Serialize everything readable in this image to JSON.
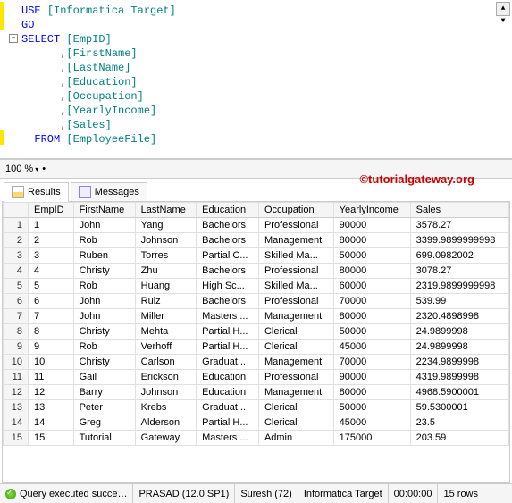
{
  "sql": {
    "line1_kw": "USE ",
    "line1_obj": "[Informatica Target]",
    "line2": "GO",
    "line3_kw": "SELECT ",
    "line3_obj": "[EmpID]",
    "line4": "      ,[FirstName]",
    "line5": "      ,[LastName]",
    "line6": "      ,[Education]",
    "line7": "      ,[Occupation]",
    "line8": "      ,[YearlyIncome]",
    "line9": "      ,[Sales]",
    "line10_kw": "  FROM ",
    "line10_obj": "[EmployeeFile]"
  },
  "zoom": {
    "level": "100 %"
  },
  "watermark": "©tutorialgateway.org",
  "tabs": {
    "results": "Results",
    "messages": "Messages"
  },
  "grid": {
    "headers": [
      "EmpID",
      "FirstName",
      "LastName",
      "Education",
      "Occupation",
      "YearlyIncome",
      "Sales"
    ],
    "rows": [
      [
        "1",
        "John",
        "Yang",
        "Bachelors",
        "Professional",
        "90000",
        "3578.27"
      ],
      [
        "2",
        "Rob",
        "Johnson",
        "Bachelors",
        "Management",
        "80000",
        "3399.9899999998"
      ],
      [
        "3",
        "Ruben",
        "Torres",
        "Partial C...",
        "Skilled Ma...",
        "50000",
        "699.0982002"
      ],
      [
        "4",
        "Christy",
        "Zhu",
        "Bachelors",
        "Professional",
        "80000",
        "3078.27"
      ],
      [
        "5",
        "Rob",
        "Huang",
        "High Sc...",
        "Skilled Ma...",
        "60000",
        "2319.9899999998"
      ],
      [
        "6",
        "John",
        "Ruiz",
        "Bachelors",
        "Professional",
        "70000",
        "539.99"
      ],
      [
        "7",
        "John",
        "Miller",
        "Masters ...",
        "Management",
        "80000",
        "2320.4898998"
      ],
      [
        "8",
        "Christy",
        "Mehta",
        "Partial H...",
        "Clerical",
        "50000",
        "24.9899998"
      ],
      [
        "9",
        "Rob",
        "Verhoff",
        "Partial H...",
        "Clerical",
        "45000",
        "24.9899998"
      ],
      [
        "10",
        "Christy",
        "Carlson",
        "Graduat...",
        "Management",
        "70000",
        "2234.9899998"
      ],
      [
        "11",
        "Gail",
        "Erickson",
        "Education",
        "Professional",
        "90000",
        "4319.9899998"
      ],
      [
        "12",
        "Barry",
        "Johnson",
        "Education",
        "Management",
        "80000",
        "4968.5900001"
      ],
      [
        "13",
        "Peter",
        "Krebs",
        "Graduat...",
        "Clerical",
        "50000",
        "59.5300001"
      ],
      [
        "14",
        "Greg",
        "Alderson",
        "Partial H...",
        "Clerical",
        "45000",
        "23.5"
      ],
      [
        "15",
        "Tutorial",
        "Gateway",
        "Masters ...",
        "Admin",
        "175000",
        "203.59"
      ]
    ]
  },
  "status": {
    "ok": "Query executed succe…",
    "server": "PRASAD (12.0 SP1)",
    "user": "Suresh (72)",
    "db": "Informatica Target",
    "time": "00:00:00",
    "rows": "15 rows"
  }
}
